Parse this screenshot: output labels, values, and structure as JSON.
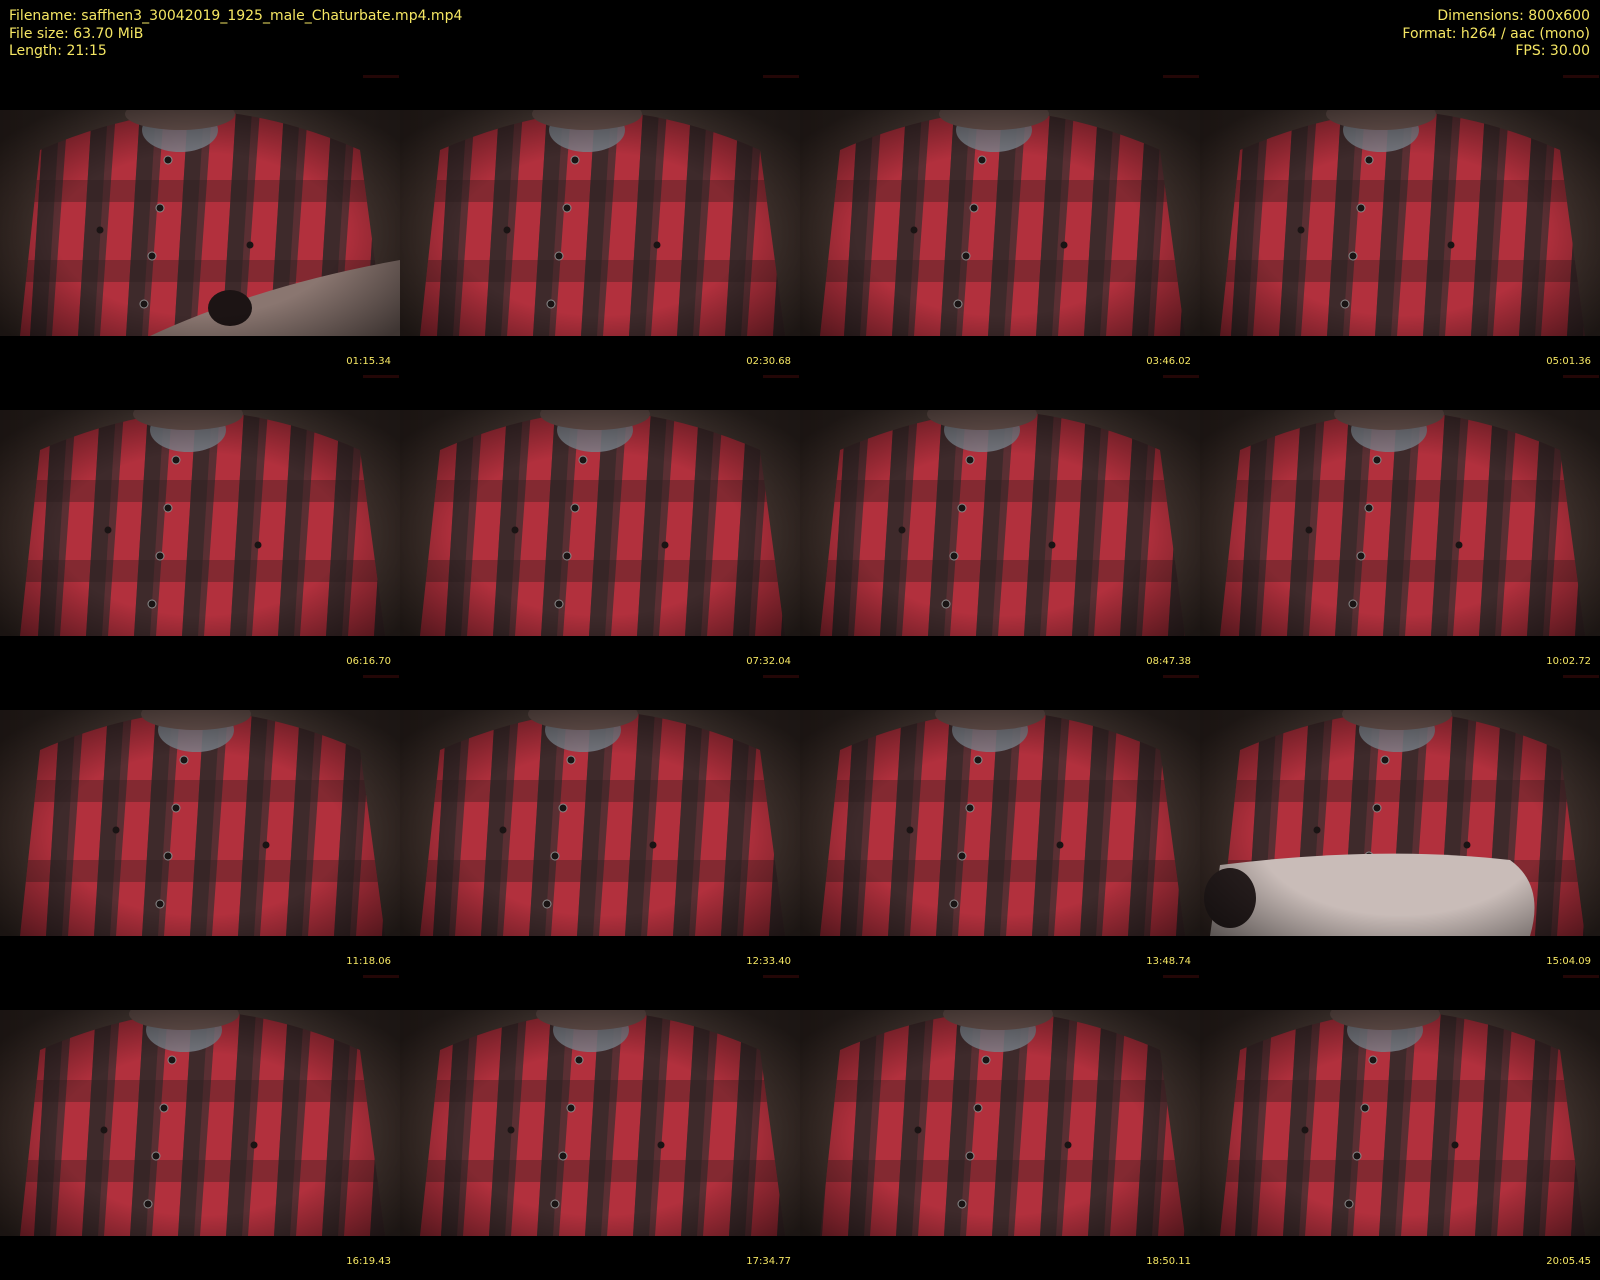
{
  "header": {
    "filename": "Filename: saffhen3_30042019_1925_male_Chaturbate.mp4.mp4",
    "filesize": "File size: 63.70 MiB",
    "length": "Length: 21:15",
    "dimensions": "Dimensions: 800x600",
    "format": "Format: h264 / aac (mono)",
    "fps": "FPS: 30.00"
  },
  "thumbnails": [
    {
      "timestamp": "01:15.34",
      "variant": "arm"
    },
    {
      "timestamp": "02:30.68",
      "variant": "shirt"
    },
    {
      "timestamp": "03:46.02",
      "variant": "shirt"
    },
    {
      "timestamp": "05:01.36",
      "variant": "shirt"
    },
    {
      "timestamp": "06:16.70",
      "variant": "shirt"
    },
    {
      "timestamp": "07:32.04",
      "variant": "shirt"
    },
    {
      "timestamp": "08:47.38",
      "variant": "shirt"
    },
    {
      "timestamp": "10:02.72",
      "variant": "shirt"
    },
    {
      "timestamp": "11:18.06",
      "variant": "shirt"
    },
    {
      "timestamp": "12:33.40",
      "variant": "shirt"
    },
    {
      "timestamp": "13:48.74",
      "variant": "shirt"
    },
    {
      "timestamp": "15:04.09",
      "variant": "forearm"
    },
    {
      "timestamp": "16:19.43",
      "variant": "shirt"
    },
    {
      "timestamp": "17:34.77",
      "variant": "shirt"
    },
    {
      "timestamp": "18:50.11",
      "variant": "shirt"
    },
    {
      "timestamp": "20:05.45",
      "variant": "shirt"
    }
  ],
  "colors": {
    "text": "#f5e663",
    "background": "#000000",
    "shirt_red": "#c2303f",
    "shirt_dark": "#3b2a2a",
    "wall": "#4a3a33"
  }
}
